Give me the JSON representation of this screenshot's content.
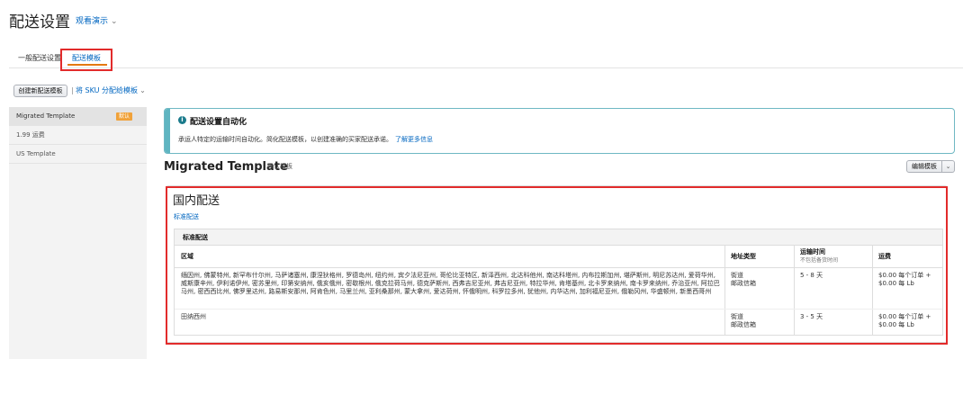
{
  "header": {
    "title": "配送设置",
    "watch_demo": "观看演示"
  },
  "tabs": [
    {
      "label": "一般配送设置"
    },
    {
      "label": "配送模板"
    }
  ],
  "toolbar": {
    "create_label": "创建新配送模板",
    "separator": "|",
    "assign_sku_label": "将 SKU 分配给模板"
  },
  "sidebar": {
    "items": [
      {
        "label": "Migrated Template",
        "badge": "默认"
      },
      {
        "label": "1.99 运费"
      },
      {
        "label": "US Template"
      }
    ]
  },
  "info": {
    "title": "配送设置自动化",
    "description": "承运人特定的运输时间自动化。简化配送模板，以创建准确的买家配送承诺。",
    "link": "了解更多信息"
  },
  "template": {
    "name": "Migrated Template",
    "default_label": "默认模板",
    "edit_label": "编辑模板"
  },
  "domestic": {
    "title": "国内配送",
    "standard_link": "标准配送",
    "table": {
      "section": "标准配送",
      "headers": {
        "region": "区域",
        "address_type": "地址类型",
        "transit_time": "运输时间",
        "transit_note": "不包括备货时间",
        "fee": "运费"
      },
      "rows": [
        {
          "region": "缅因州, 佛蒙特州, 新罕布什尔州, 马萨诸塞州, 康涅狄格州, 罗德岛州, 纽约州, 宾夕法尼亚州, 哥伦比亚特区, 新泽西州, 北达科他州, 南达科塔州, 内布拉斯加州, 堪萨斯州, 明尼苏达州, 爱荷华州, 威斯康辛州, 伊利诺伊州, 密苏里州, 印第安纳州, 俄亥俄州, 密歇根州, 俄克拉荷马州, 德克萨斯州, 西弗吉尼亚州, 弗吉尼亚州, 特拉华州, 肯塔基州, 北卡罗来纳州, 南卡罗来纳州, 乔治亚州, 阿拉巴马州, 密西西比州, 佛罗里达州, 路易斯安那州, 阿肯色州, 马里兰州, 亚利桑那州, 蒙大拿州, 爱达荷州, 怀俄明州, 科罗拉多州, 犹他州, 内华达州, 加利福尼亚州, 俄勒冈州, 华盛顿州, 新墨西哥州",
          "address_type_1": "街道",
          "address_type_2": "邮政信箱",
          "transit": "5 - 8 天",
          "fee_1": "$0.00 每个订单 +",
          "fee_2": "$0.00 每 Lb"
        },
        {
          "region": "田纳西州",
          "address_type_1": "街道",
          "address_type_2": "邮政信箱",
          "transit": "3 - 5 天",
          "fee_1": "$0.00 每个订单 +",
          "fee_2": "$0.00 每 Lb"
        }
      ]
    }
  }
}
